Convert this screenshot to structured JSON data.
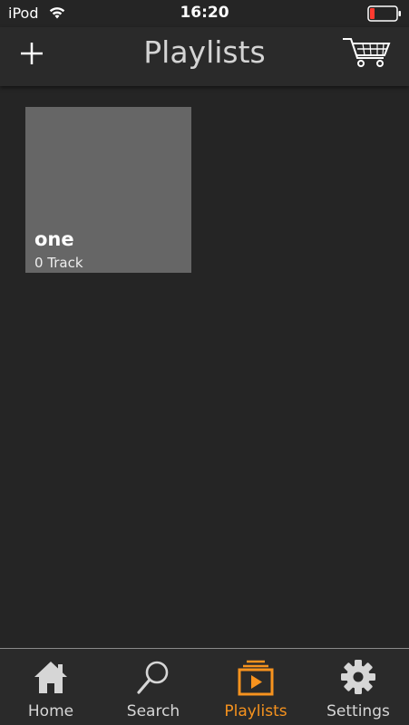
{
  "status": {
    "carrier": "iPod",
    "time": "16:20"
  },
  "nav": {
    "title": "Playlists",
    "add_icon": "plus-icon",
    "cart_icon": "cart-icon"
  },
  "playlists": [
    {
      "name": "one",
      "count": "0 Track"
    }
  ],
  "tabs": [
    {
      "label": "Home",
      "icon": "home-icon",
      "active": false
    },
    {
      "label": "Search",
      "icon": "search-icon",
      "active": false
    },
    {
      "label": "Playlists",
      "icon": "playlists-icon",
      "active": true
    },
    {
      "label": "Settings",
      "icon": "gear-icon",
      "active": false
    }
  ],
  "colors": {
    "background": "#252525",
    "accent": "#f7931e",
    "card": "#666666",
    "battery_low": "#ff3b30"
  }
}
